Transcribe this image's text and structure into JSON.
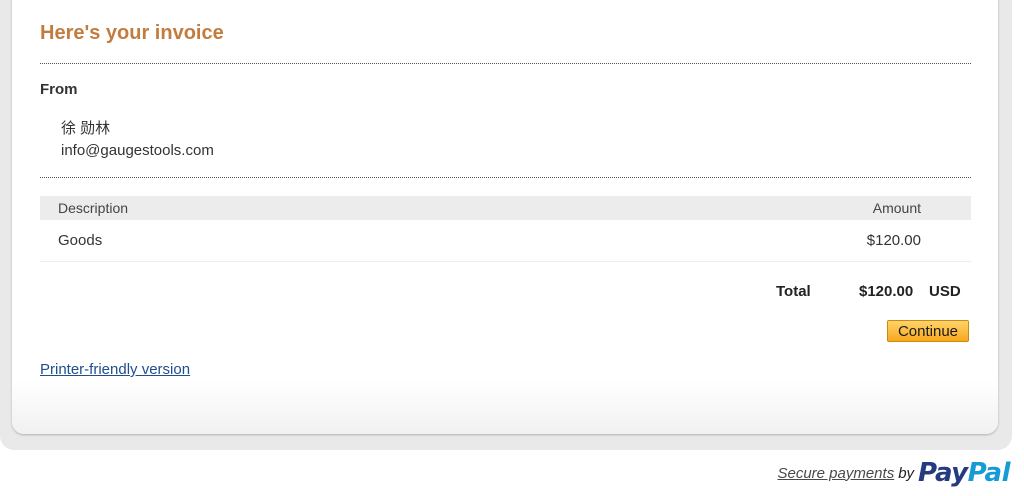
{
  "invoice": {
    "title": "Here's your invoice",
    "from_label": "From",
    "sender_name": "徐 勋林",
    "sender_email": "info@gaugestools.com"
  },
  "table": {
    "headers": [
      "Description",
      "Amount"
    ],
    "rows": [
      {
        "description": "Goods",
        "amount": "$120.00"
      }
    ]
  },
  "totals": {
    "label": "Total",
    "amount": "$120.00",
    "currency": "USD"
  },
  "actions": {
    "continue_label": "Continue",
    "printer_link": "Printer-friendly version"
  },
  "footer": {
    "secure_link": "Secure payments",
    "by": "by",
    "logo_pay": "Pay",
    "logo_pal": "Pal"
  },
  "colors": {
    "title": "#c27d3e",
    "button_top": "#ffd36b",
    "button_bottom": "#f7a91c",
    "link": "#1f4d8f",
    "paypal_dark": "#253b80",
    "paypal_light": "#179bd7"
  }
}
